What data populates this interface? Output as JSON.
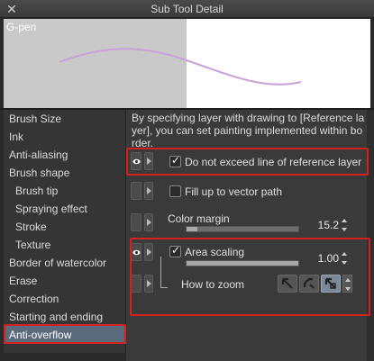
{
  "window": {
    "title": "Sub Tool Detail",
    "close_glyph": "✕"
  },
  "preview": {
    "label": "G-pen"
  },
  "sidebar": {
    "items": [
      {
        "label": "Brush Size",
        "sub": false
      },
      {
        "label": "Ink",
        "sub": false
      },
      {
        "label": "Anti-aliasing",
        "sub": false
      },
      {
        "label": "Brush shape",
        "sub": false
      },
      {
        "label": "Brush tip",
        "sub": true
      },
      {
        "label": "Spraying effect",
        "sub": true
      },
      {
        "label": "Stroke",
        "sub": true
      },
      {
        "label": "Texture",
        "sub": true
      },
      {
        "label": "Border of watercolor",
        "sub": false
      },
      {
        "label": "Erase",
        "sub": false
      },
      {
        "label": "Correction",
        "sub": false
      },
      {
        "label": "Starting and ending",
        "sub": false
      },
      {
        "label": "Anti-overflow",
        "sub": false,
        "active": true
      }
    ]
  },
  "main": {
    "description_line1": "By specifying layer with drawing to [Reference la",
    "description_line2": "yer], you can set painting implemented within bo",
    "description_line3": "rder.",
    "settings": {
      "do_not_exceed": {
        "label": "Do not exceed line of reference layer",
        "checked": true
      },
      "fill_up_vector": {
        "label": "Fill up to vector path",
        "checked": false
      },
      "color_margin": {
        "label": "Color margin",
        "value": "15.2",
        "level": 0.1
      },
      "area_scaling": {
        "label": "Area scaling",
        "checked": true,
        "value": "1.00",
        "level": 1.0
      },
      "how_to_zoom": {
        "label": "How to zoom",
        "selected_index": 2
      }
    },
    "check_glyph": "✓"
  },
  "colors": {
    "highlight": "#d62020",
    "active_item": "#5a6a7d",
    "stroke": "#c9a0d8"
  }
}
